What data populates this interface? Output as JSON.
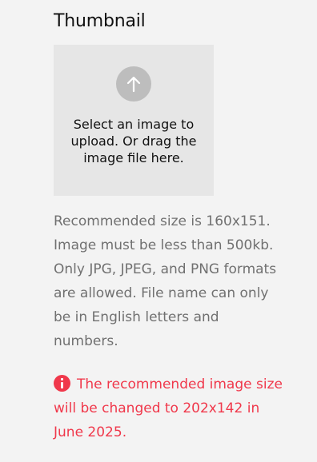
{
  "thumbnail": {
    "title": "Thumbnail",
    "dropzone": {
      "icon": "upload-arrow-icon",
      "text": "Select an image to upload. Or drag the image file here."
    },
    "help_text": "Recommended size is 160x151. Image must be less than 500kb. Only JPG, JPEG, and PNG formats are allowed. File name can only be in English letters and numbers.",
    "notice": {
      "icon": "info-icon",
      "text": "The recommended image size will be changed to 202x142 in June 2025.",
      "color": "#f0384b"
    }
  },
  "colors": {
    "background": "#f3f3f3",
    "dropzone": "#e6e6e6",
    "icon_circle": "#bdbdbd",
    "help_text": "#707070"
  }
}
